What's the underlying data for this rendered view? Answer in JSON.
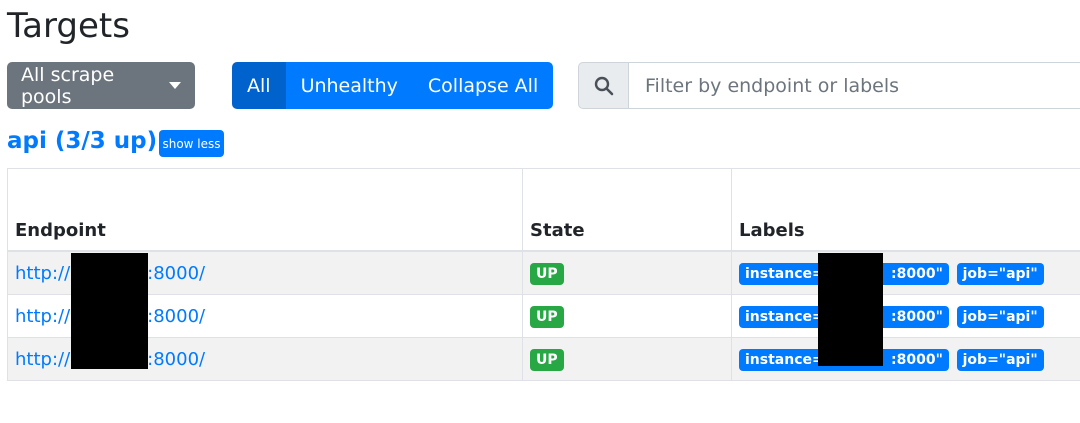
{
  "page": {
    "title": "Targets"
  },
  "toolbar": {
    "scrape_pools_label": "All scrape pools",
    "filters": [
      "All",
      "Unhealthy",
      "Collapse All"
    ]
  },
  "search": {
    "placeholder": "Filter by endpoint or labels",
    "value": ""
  },
  "pool": {
    "heading": "api (3/3 up)",
    "toggle_label": "show less"
  },
  "table": {
    "headers": {
      "endpoint": "Endpoint",
      "state": "State",
      "labels": "Labels"
    },
    "rows": [
      {
        "endpoint_prefix": "http://",
        "endpoint_suffix": ":8000/",
        "state": "UP",
        "instance_prefix": "instance=\"",
        "instance_suffix": ":8000\"",
        "job": "job=\"api\""
      },
      {
        "endpoint_prefix": "http://",
        "endpoint_suffix": ":8000/",
        "state": "UP",
        "instance_prefix": "instance=\"",
        "instance_suffix": ":8000\"",
        "job": "job=\"api\""
      },
      {
        "endpoint_prefix": "http://",
        "endpoint_suffix": ":8000/",
        "state": "UP",
        "instance_prefix": "instance=\"",
        "instance_suffix": ":8000\"",
        "job": "job=\"api\""
      }
    ]
  },
  "colors": {
    "primary": "#007bff",
    "secondary": "#6c757d",
    "success": "#28a745",
    "redaction": "#000000"
  }
}
